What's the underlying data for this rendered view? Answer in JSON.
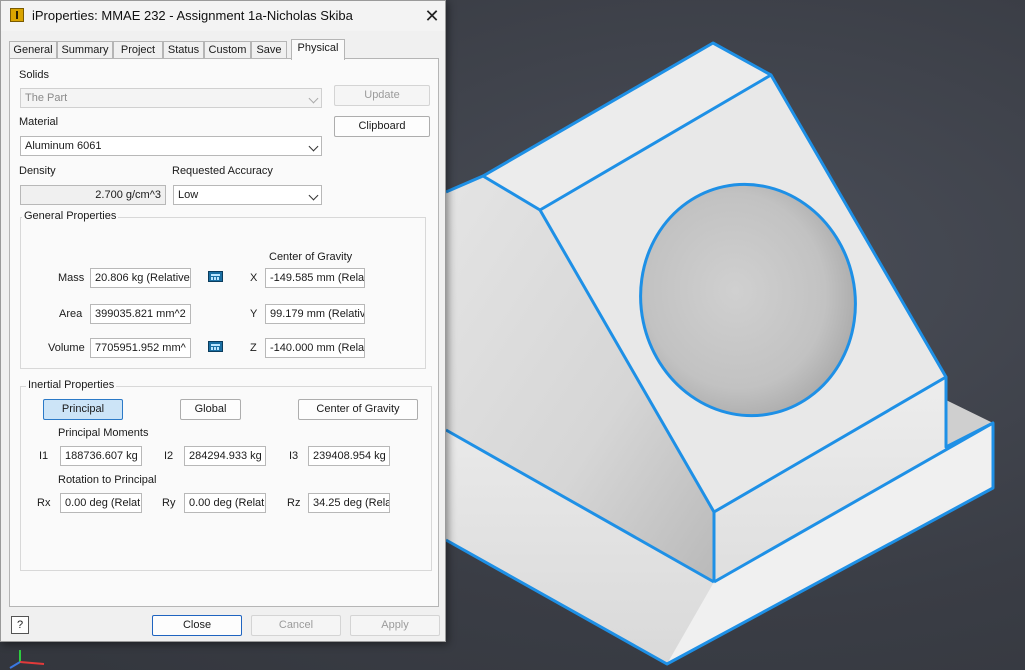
{
  "window": {
    "title": "iProperties: MMAE 232 - Assignment 1a-Nicholas Skiba"
  },
  "tabs": [
    {
      "label": "General"
    },
    {
      "label": "Summary"
    },
    {
      "label": "Project"
    },
    {
      "label": "Status"
    },
    {
      "label": "Custom"
    },
    {
      "label": "Save"
    },
    {
      "label": "Physical"
    }
  ],
  "physical": {
    "solids_label": "Solids",
    "solids_value": "The Part",
    "update_button": "Update",
    "clipboard_button": "Clipboard",
    "material_label": "Material",
    "material_value": "Aluminum 6061",
    "density_label": "Density",
    "density_value": "2.700 g/cm^3",
    "accuracy_label": "Requested Accuracy",
    "accuracy_value": "Low"
  },
  "general_props": {
    "title": "General Properties",
    "cog_label": "Center of Gravity",
    "mass_label": "Mass",
    "mass_value": "20.806 kg (Relative",
    "area_label": "Area",
    "area_value": "399035.821 mm^2",
    "volume_label": "Volume",
    "volume_value": "7705951.952 mm^",
    "x_label": "X",
    "x_value": "-149.585 mm (Relat",
    "y_label": "Y",
    "y_value": "99.179 mm (Relativ",
    "z_label": "Z",
    "z_value": "-140.000 mm (Relat"
  },
  "inertial": {
    "title": "Inertial Properties",
    "principal_button": "Principal",
    "global_button": "Global",
    "cog_button": "Center of Gravity",
    "moments_label": "Principal Moments",
    "i1_label": "I1",
    "i1_value": "188736.607 kg",
    "i2_label": "I2",
    "i2_value": "284294.933 kg",
    "i3_label": "I3",
    "i3_value": "239408.954 kg",
    "rotation_label": "Rotation to Principal",
    "rx_label": "Rx",
    "rx_value": "0.00 deg (Relat",
    "ry_label": "Ry",
    "ry_value": "0.00 deg (Relat",
    "rz_label": "Rz",
    "rz_value": "34.25 deg (Rela"
  },
  "footer": {
    "help_icon": "?",
    "close_button": "Close",
    "cancel_button": "Cancel",
    "apply_button": "Apply"
  },
  "colors": {
    "edge_highlight": "#1e90e6",
    "viewport_bg": "#3a3d45",
    "part_face": "#e6e6e6"
  }
}
